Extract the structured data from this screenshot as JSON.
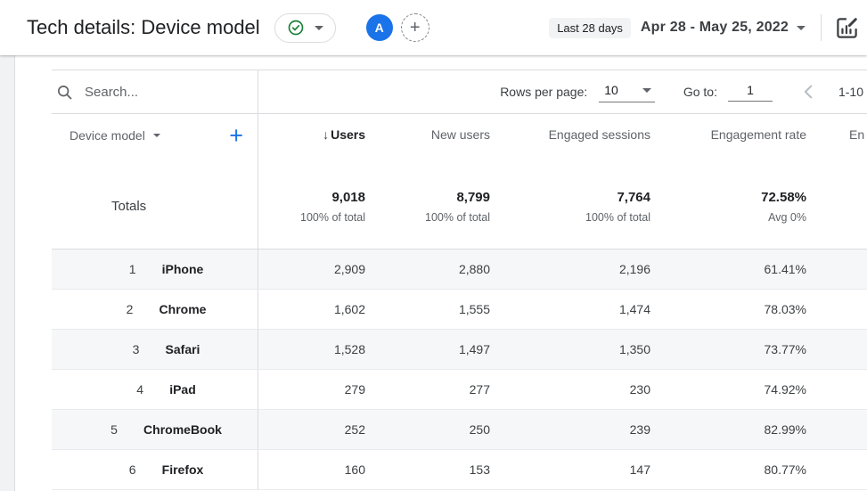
{
  "app_bar": {
    "title": "Tech details: Device model",
    "avatar_letter": "A",
    "date_chip": "Last 28 days",
    "date_range": "Apr 28 - May 25, 2022"
  },
  "toolbar": {
    "search_placeholder": "Search...",
    "rows_per_page_label": "Rows per page:",
    "rows_per_page_value": "10",
    "goto_label": "Go to:",
    "goto_value": "1",
    "page_range": "1-10"
  },
  "table": {
    "dimension_header": "Device model",
    "sort_arrow": "↓",
    "columns": [
      "Users",
      "New users",
      "Engaged sessions",
      "Engagement rate",
      "En"
    ],
    "totals_label": "Totals",
    "totals": [
      {
        "value": "9,018",
        "sub": "100% of total"
      },
      {
        "value": "8,799",
        "sub": "100% of total"
      },
      {
        "value": "7,764",
        "sub": "100% of total"
      },
      {
        "value": "72.58%",
        "sub": "Avg 0%"
      }
    ],
    "rows": [
      {
        "rank": "1",
        "name": "iPhone",
        "users": "2,909",
        "new_users": "2,880",
        "engaged_sessions": "2,196",
        "engagement_rate": "61.41%"
      },
      {
        "rank": "2",
        "name": "Chrome",
        "users": "1,602",
        "new_users": "1,555",
        "engaged_sessions": "1,474",
        "engagement_rate": "78.03%"
      },
      {
        "rank": "3",
        "name": "Safari",
        "users": "1,528",
        "new_users": "1,497",
        "engaged_sessions": "1,350",
        "engagement_rate": "73.77%"
      },
      {
        "rank": "4",
        "name": "iPad",
        "users": "279",
        "new_users": "277",
        "engaged_sessions": "230",
        "engagement_rate": "74.92%"
      },
      {
        "rank": "5",
        "name": "ChromeBook",
        "users": "252",
        "new_users": "250",
        "engaged_sessions": "239",
        "engagement_rate": "82.99%"
      },
      {
        "rank": "6",
        "name": "Firefox",
        "users": "160",
        "new_users": "153",
        "engaged_sessions": "147",
        "engagement_rate": "80.77%"
      }
    ]
  },
  "icons": {
    "plus": "+"
  },
  "colors": {
    "accent_blue": "#1a73e8",
    "check_green": "#188038"
  }
}
